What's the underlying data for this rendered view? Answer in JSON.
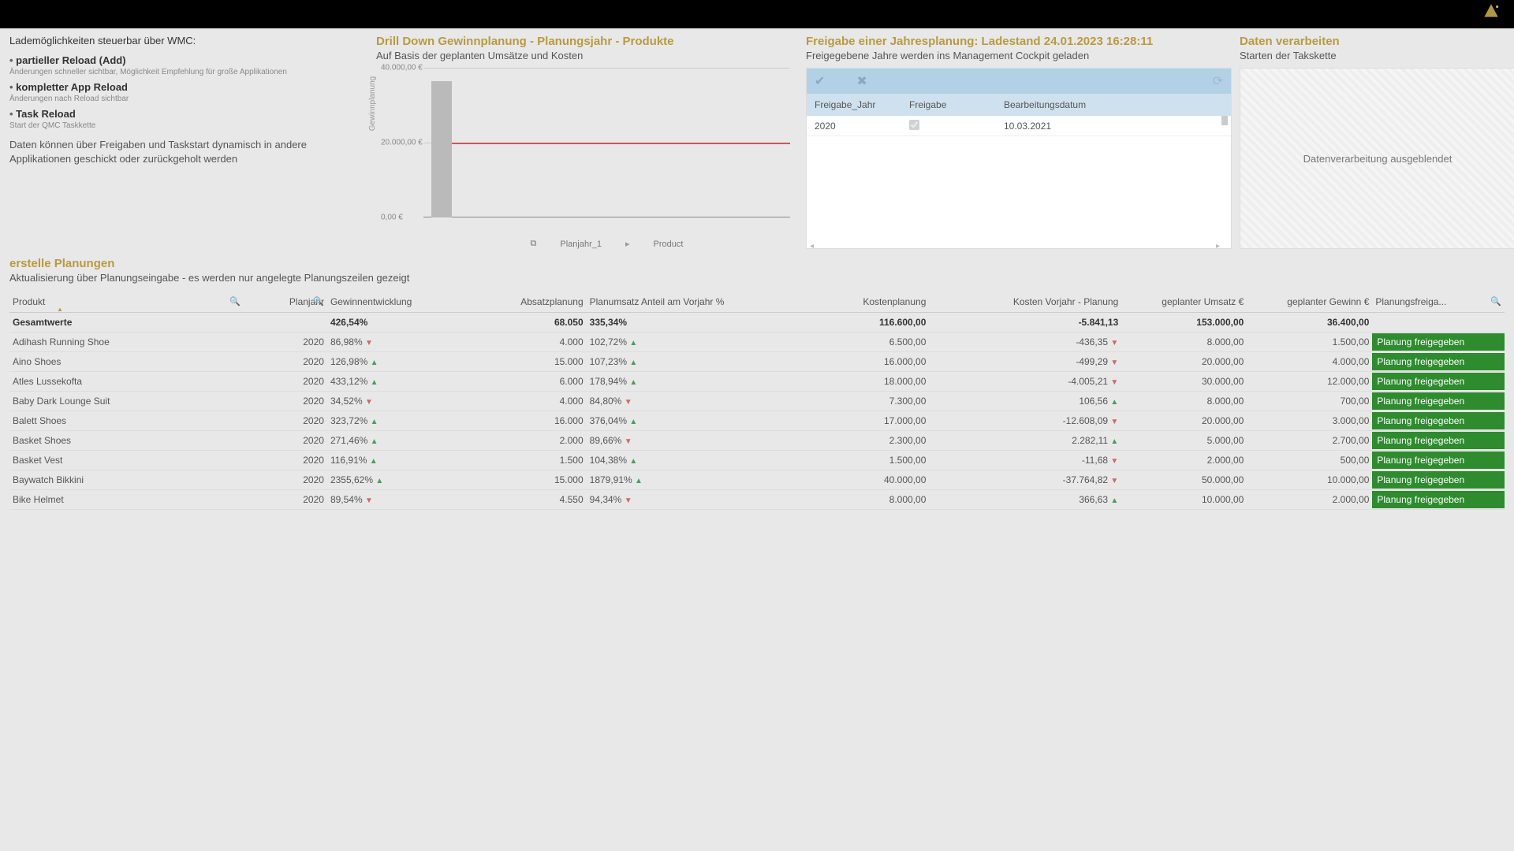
{
  "info": {
    "heading": "Lademöglichkeiten steuerbar über WMC:",
    "b1": "partieller Reload (Add)",
    "b1_note": "Änderungen schneller sichtbar, Möglichkeit Empfehlung für große Applikationen",
    "b2": "kompletter App Reload",
    "b2_note": "Änderungen nach Reload sichtbar",
    "b3": "Task Reload",
    "b3_note": "Start der QMC Taskkette",
    "para": "Daten können über Freigaben und Taskstart dynamisch in andere Applikationen geschickt oder zurückgeholt werden"
  },
  "drilldown": {
    "title": "Drill Down Gewinnplanung - Planungsjahr - Produkte",
    "sub": "Auf Basis der geplanten Umsätze und Kosten",
    "ylabel": "Gewinnplanung",
    "tick_top": "40.000,00 €",
    "tick_mid": "20.000,00 €",
    "tick_bot": "0,00 €",
    "bc1": "Planjahr_1",
    "bc2": "Product"
  },
  "freigabe": {
    "title": "Freigabe einer Jahresplanung: Ladestand 24.01.2023 16:28:11",
    "sub": "Freigegebene Jahre werden ins Management Cockpit geladen",
    "h1": "Freigabe_Jahr",
    "h2": "Freigabe",
    "h3": "Bearbeitungsdatum",
    "row_year": "2020",
    "row_date": "10.03.2021"
  },
  "daten": {
    "title": "Daten verarbeiten",
    "sub": "Starten der Takskette",
    "msg": "Datenverarbeitung ausgeblendet"
  },
  "erstelle": {
    "title": "erstelle Planungen",
    "sub": "Aktualisierung über Planungseingabe - es werden nur angelegte Planungszeilen gezeigt"
  },
  "headers": {
    "produkt": "Produkt",
    "planjahr": "Planjahr",
    "gewinn": "Gewinnentwicklung",
    "absatz": "Absatzplanung",
    "anteil": "Planumsatz Anteil am Vorjahr %",
    "kosten": "Kostenplanung",
    "kvorjahr": "Kosten Vorjahr - Planung",
    "umsatz": "geplanter Umsatz €",
    "gewinnplan": "geplanter Gewinn €",
    "freigabe": "Planungsfreiga..."
  },
  "totals": {
    "label": "Gesamtwerte",
    "gewinn": "426,54%",
    "absatz": "68.050",
    "anteil": "335,34%",
    "kosten": "116.600,00",
    "kvorjahr": "-5.841,13",
    "umsatz": "153.000,00",
    "gewinnplan": "36.400,00"
  },
  "rows": [
    {
      "p": "Adihash Running Shoe",
      "j": "2020",
      "g": "86,98%",
      "gd": "down",
      "a": "4.000",
      "an": "102,72%",
      "and": "up",
      "k": "6.500,00",
      "kv": "-436,35",
      "kvd": "down",
      "u": "8.000,00",
      "gp": "1.500,00",
      "f": "Planung freigegeben"
    },
    {
      "p": "Aino Shoes",
      "j": "2020",
      "g": "126,98%",
      "gd": "up",
      "a": "15.000",
      "an": "107,23%",
      "and": "up",
      "k": "16.000,00",
      "kv": "-499,29",
      "kvd": "down",
      "u": "20.000,00",
      "gp": "4.000,00",
      "f": "Planung freigegeben"
    },
    {
      "p": "Atles Lussekofta",
      "j": "2020",
      "g": "433,12%",
      "gd": "up",
      "a": "6.000",
      "an": "178,94%",
      "and": "up",
      "k": "18.000,00",
      "kv": "-4.005,21",
      "kvd": "down",
      "u": "30.000,00",
      "gp": "12.000,00",
      "f": "Planung freigegeben"
    },
    {
      "p": "Baby Dark Lounge Suit",
      "j": "2020",
      "g": "34,52%",
      "gd": "down",
      "a": "4.000",
      "an": "84,80%",
      "and": "down",
      "k": "7.300,00",
      "kv": "106,56",
      "kvd": "up",
      "u": "8.000,00",
      "gp": "700,00",
      "f": "Planung freigegeben"
    },
    {
      "p": "Balett Shoes",
      "j": "2020",
      "g": "323,72%",
      "gd": "up",
      "a": "16.000",
      "an": "376,04%",
      "and": "up",
      "k": "17.000,00",
      "kv": "-12.608,09",
      "kvd": "down",
      "u": "20.000,00",
      "gp": "3.000,00",
      "f": "Planung freigegeben"
    },
    {
      "p": "Basket Shoes",
      "j": "2020",
      "g": "271,46%",
      "gd": "up",
      "a": "2.000",
      "an": "89,66%",
      "and": "down",
      "k": "2.300,00",
      "kv": "2.282,11",
      "kvd": "up",
      "u": "5.000,00",
      "gp": "2.700,00",
      "f": "Planung freigegeben"
    },
    {
      "p": "Basket Vest",
      "j": "2020",
      "g": "116,91%",
      "gd": "up",
      "a": "1.500",
      "an": "104,38%",
      "and": "up",
      "k": "1.500,00",
      "kv": "-11,68",
      "kvd": "down",
      "u": "2.000,00",
      "gp": "500,00",
      "f": "Planung freigegeben"
    },
    {
      "p": "Baywatch Bikkini",
      "j": "2020",
      "g": "2355,62%",
      "gd": "up",
      "a": "15.000",
      "an": "1879,91%",
      "and": "up",
      "k": "40.000,00",
      "kv": "-37.764,82",
      "kvd": "down",
      "u": "50.000,00",
      "gp": "10.000,00",
      "f": "Planung freigegeben"
    },
    {
      "p": "Bike Helmet",
      "j": "2020",
      "g": "89,54%",
      "gd": "down",
      "a": "4.550",
      "an": "94,34%",
      "and": "down",
      "k": "8.000,00",
      "kv": "366,63",
      "kvd": "up",
      "u": "10.000,00",
      "gp": "2.000,00",
      "f": "Planung freigegeben"
    }
  ],
  "chart_data": {
    "type": "bar",
    "categories": [
      "-"
    ],
    "values": [
      36400
    ],
    "reference_line": 20000,
    "title": "Drill Down Gewinnplanung - Planungsjahr - Produkte",
    "xlabel": "Planjahr_1 > Product",
    "ylabel": "Gewinnplanung",
    "ylim": [
      0,
      40000
    ],
    "y_ticks": [
      "0,00 €",
      "20.000,00 €",
      "40.000,00 €"
    ]
  }
}
